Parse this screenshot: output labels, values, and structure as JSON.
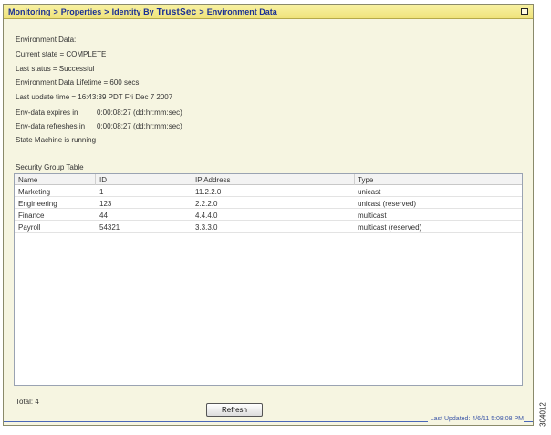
{
  "breadcrumb": {
    "items": [
      "Monitoring",
      "Properties",
      "Identity By",
      "TrustSec",
      "Environment Data"
    ],
    "separator": ">"
  },
  "environment": {
    "heading": "Environment Data:",
    "lines": [
      "Current state = COMPLETE",
      "Last status = Successful",
      "Environment Data Lifetime = 600 secs",
      "Last update time = 16:43:39 PDT Fri Dec 7 2007"
    ],
    "expires_label": "Env-data expires in",
    "expires_value": "0:00:08:27 (dd:hr:mm:sec)",
    "refreshes_label": "Env-data refreshes in",
    "refreshes_value": "0:00:08:27 (dd:hr:mm:sec)",
    "state_machine": "State Machine is running"
  },
  "security_group_table": {
    "title": "Security Group Table",
    "columns": [
      "Name",
      "ID",
      "IP Address",
      "Type"
    ],
    "rows": [
      [
        "Marketing",
        "1",
        "11.2.2.0",
        "unicast"
      ],
      [
        "Engineering",
        "123",
        "2.2.2.0",
        "unicast (reserved)"
      ],
      [
        "Finance",
        "44",
        "4.4.4.0",
        "multicast"
      ],
      [
        "Payroll",
        "54321",
        "3.3.3.0",
        "multicast (reserved)"
      ]
    ]
  },
  "total": "Total: 4",
  "refresh_label": "Refresh",
  "last_updated": "Last Updated: 4/6/11 5:08:08 PM",
  "figure_number": "304012",
  "colors": {
    "title_bar": "#f1e786",
    "title_text": "#1a2f95",
    "panel_background": "#f6f5e1",
    "status_text": "#3d57a8"
  },
  "icons": {
    "maximize": "maximize-icon"
  }
}
